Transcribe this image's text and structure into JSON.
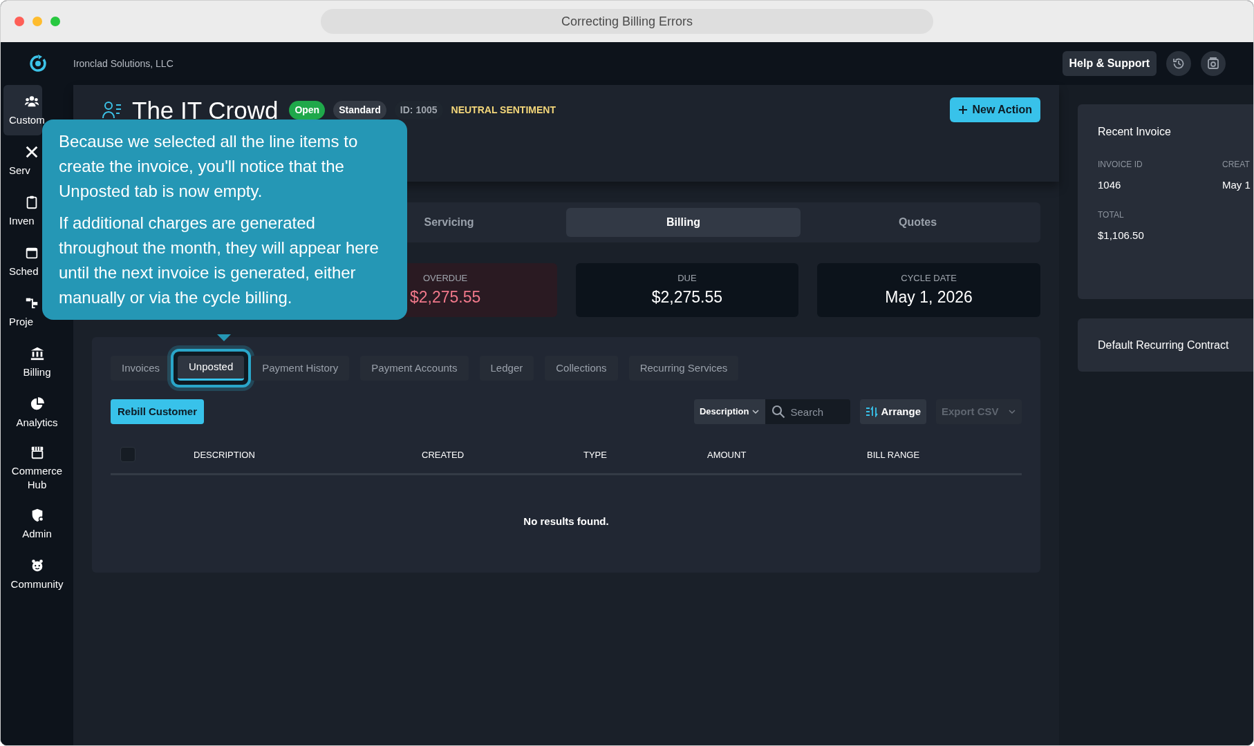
{
  "window": {
    "title": "Correcting Billing Errors"
  },
  "app_bar": {
    "company": "Ironclad Solutions, LLC",
    "help_button": "Help & Support"
  },
  "sidebar": {
    "items": [
      {
        "label": "Custom",
        "selected": true
      },
      {
        "label": "Serv",
        "selected": false
      },
      {
        "label": "Inven",
        "selected": false
      },
      {
        "label": "Sched",
        "selected": false
      },
      {
        "label": "Proje",
        "selected": false
      },
      {
        "label": "Billing",
        "selected": false
      },
      {
        "label": "Analytics",
        "selected": false
      },
      {
        "label": "Commerce Hub",
        "selected": false
      },
      {
        "label": "Admin",
        "selected": false
      },
      {
        "label": "Community",
        "selected": false
      }
    ]
  },
  "header": {
    "title": "The IT Crowd",
    "badges": [
      {
        "text": "Open",
        "kind": "status"
      },
      {
        "text": "Standard",
        "kind": "tier"
      },
      {
        "text": "ID: 1005",
        "kind": "id"
      },
      {
        "text": "NEUTRAL SENTIMENT",
        "kind": "sentiment"
      }
    ],
    "action_button": "New Action"
  },
  "tabs": [
    {
      "label": "Servicing",
      "selected": false
    },
    {
      "label": "Billing",
      "selected": true
    },
    {
      "label": "Quotes",
      "selected": false
    }
  ],
  "stats": [
    {
      "label": "OVERDUE",
      "value": "$2,275.55",
      "kind": "overdue"
    },
    {
      "label": "DUE",
      "value": "$2,275.55",
      "kind": "normal"
    },
    {
      "label": "CYCLE DATE",
      "value": "May 1, 2026",
      "kind": "normal"
    }
  ],
  "subtabs": [
    {
      "label": "Invoices",
      "selected": false,
      "highlighted": false
    },
    {
      "label": "Unposted",
      "selected": true,
      "highlighted": true
    },
    {
      "label": "Payment History",
      "selected": false,
      "highlighted": false
    },
    {
      "label": "Payment Accounts",
      "selected": false,
      "highlighted": false
    },
    {
      "label": "Ledger",
      "selected": false,
      "highlighted": false
    },
    {
      "label": "Collections",
      "selected": false,
      "highlighted": false
    },
    {
      "label": "Recurring Services",
      "selected": false,
      "highlighted": false
    }
  ],
  "toolbar": {
    "primary_button": "Rebill Customer",
    "filter": "Description",
    "search": {
      "placeholder": "Search"
    },
    "arrange_button": "Arrange",
    "export_button": {
      "label": "Export CSV",
      "disabled": true
    }
  },
  "table": {
    "select_all": {
      "checked": false
    },
    "columns": [
      "DESCRIPTION",
      "CREATED",
      "TYPE",
      "AMOUNT",
      "BILL RANGE"
    ],
    "empty_message": "No results found."
  },
  "tooltip": {
    "paragraphs": [
      "Because we selected all the line items to create the invoice, you'll notice that the Unposted tab is now empty.",
      "If additional charges are generated throughout the month, they will appear here until the next invoice is generated, either manually or via the cycle billing."
    ]
  },
  "right_panel": {
    "recent_invoice": {
      "title": "Recent Invoice",
      "fields": [
        {
          "label": "INVOICE ID",
          "value": "1046"
        },
        {
          "label": "CREAT",
          "value": "May 1"
        },
        {
          "label": "TOTAL",
          "value": "$1,106.50"
        }
      ]
    },
    "contract": {
      "title": "Default Recurring Contract"
    }
  }
}
